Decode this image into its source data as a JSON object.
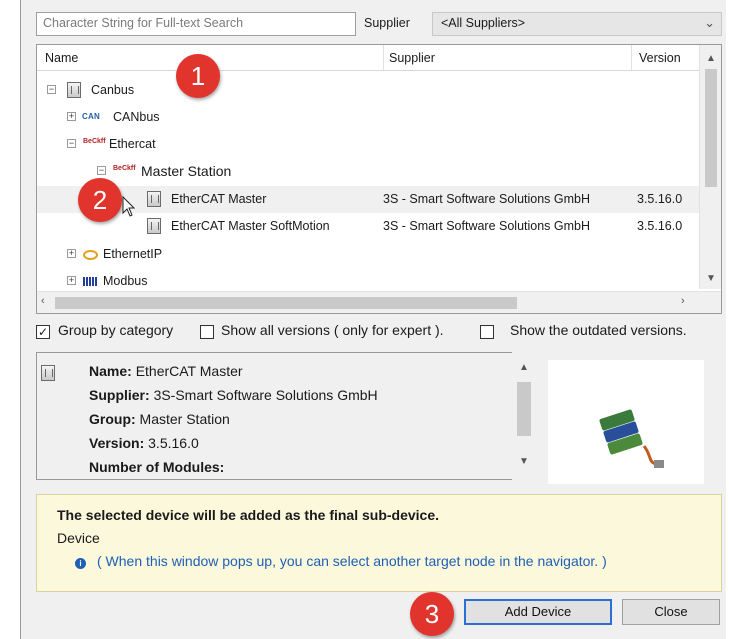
{
  "search": {
    "placeholder": "Character String for Full-text Search",
    "supplier_label": "Supplier",
    "supplier_value": "<All Suppliers>"
  },
  "list": {
    "columns": [
      "Name",
      "Supplier",
      "Version"
    ],
    "rows": [
      {
        "name": "Canbus",
        "supplier": "",
        "version": "",
        "icon": "device-icon",
        "expander": "−"
      },
      {
        "name": "CANbus",
        "supplier": "",
        "version": "",
        "icon": "can-icon",
        "icon_text": "CAN",
        "expander": "+"
      },
      {
        "name": "Ethercat",
        "supplier": "",
        "version": "",
        "icon": "beckhoff-icon",
        "icon_text": "BeCkff",
        "expander": "−"
      },
      {
        "name": "Master Station",
        "supplier": "",
        "version": "",
        "icon": "beckhoff-icon",
        "icon_text": "BeCkff",
        "expander": "−"
      },
      {
        "name": "EtherCAT Master",
        "supplier": "3S - Smart Software Solutions GmbH",
        "version": "3.5.16.0",
        "icon": "device-icon",
        "selected": true
      },
      {
        "name": "EtherCAT Master SoftMotion",
        "supplier": "3S - Smart Software Solutions GmbH",
        "version": "3.5.16.0",
        "icon": "device-icon"
      },
      {
        "name": "EthernetIP",
        "supplier": "",
        "version": "",
        "icon": "ethernetip-icon",
        "expander": "+"
      },
      {
        "name": "Modbus",
        "supplier": "",
        "version": "",
        "icon": "modbus-icon",
        "expander": "+"
      }
    ]
  },
  "options": {
    "group_by_category": {
      "label": "Group by category",
      "checked": true
    },
    "show_all_versions": {
      "label": "Show all versions ( only for expert ).",
      "checked": false
    },
    "show_outdated": {
      "label": "Show the outdated versions.",
      "checked": false
    }
  },
  "info": {
    "name_label": "Name:",
    "name_value": "EtherCAT Master",
    "supplier_label": "Supplier:",
    "supplier_value": "3S-Smart Software Solutions GmbH",
    "group_label": "Group:",
    "group_value": "Master Station",
    "version_label": "Version:",
    "version_value": "3.5.16.0",
    "modules_label": "Number of Modules:"
  },
  "message": {
    "title": "The selected device will be added as the final sub-device.",
    "device": "Device",
    "hint": "( When this window pops up, you can select another target node in the navigator. )"
  },
  "buttons": {
    "add_device": "Add Device",
    "close": "Close"
  },
  "callouts": [
    "1",
    "2",
    "3"
  ],
  "colors": {
    "callout": "#e0342c",
    "hint_text": "#1f5fb5",
    "message_bg": "#fbf8dc",
    "selected_row": "#f0f0f0"
  }
}
